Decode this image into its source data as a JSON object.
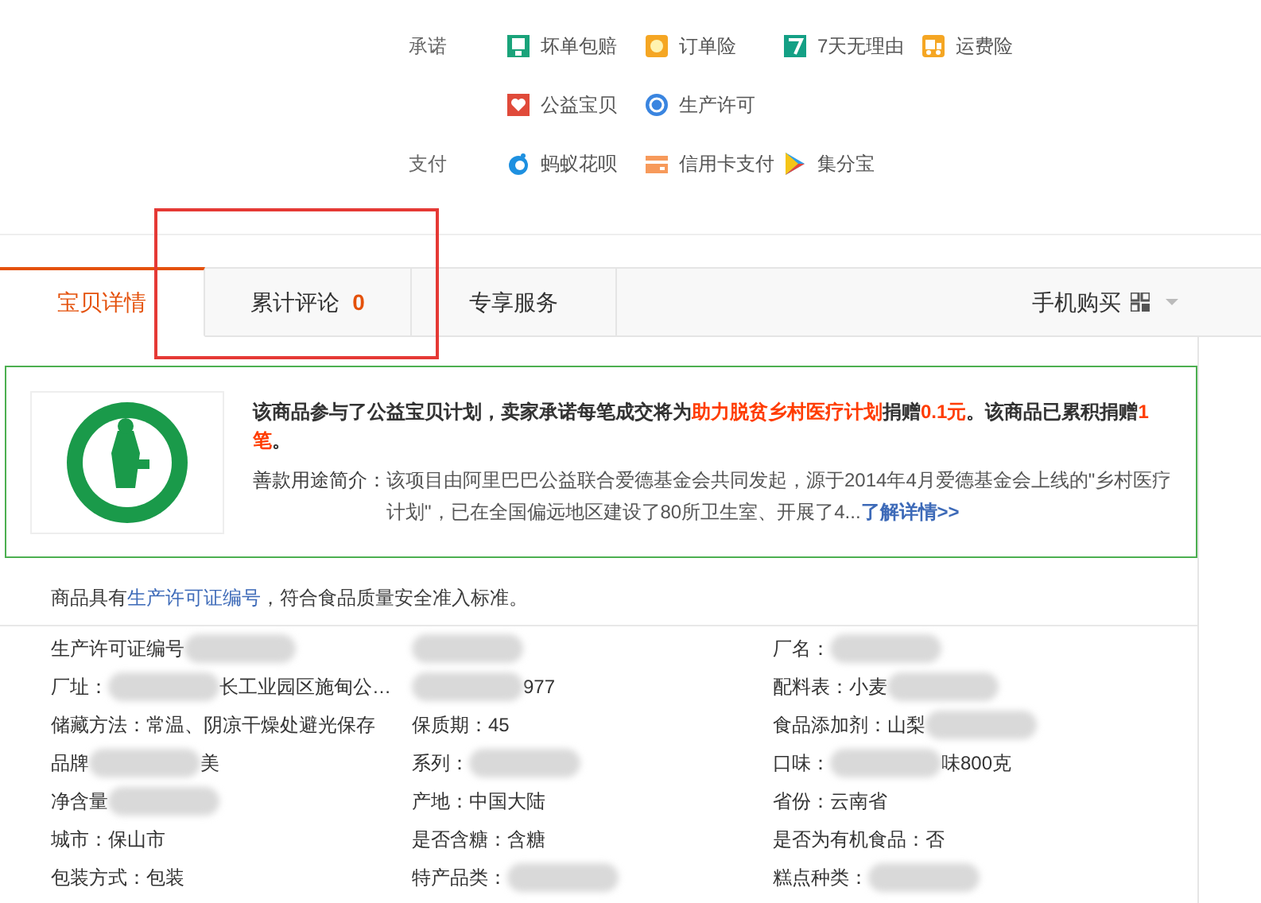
{
  "services": [
    {
      "label": "承诺",
      "items": [
        {
          "text": "坏单包赔",
          "kind": "refund"
        },
        {
          "text": "订单险",
          "kind": "sun"
        },
        {
          "text": "7天无理由",
          "kind": "seven"
        },
        {
          "text": "运费险",
          "kind": "truck"
        },
        {
          "text": "公益宝贝",
          "kind": "heart"
        },
        {
          "text": "生产许可",
          "kind": "license"
        }
      ]
    },
    {
      "label": "支付",
      "items": [
        {
          "text": "蚂蚁花呗",
          "kind": "drop"
        },
        {
          "text": "信用卡支付",
          "kind": "card"
        },
        {
          "text": "集分宝",
          "kind": "play"
        }
      ]
    }
  ],
  "tabs": [
    {
      "label": "宝贝详情",
      "selected": true
    },
    {
      "label": "累计评论",
      "count": "0",
      "selected": false
    },
    {
      "label": "专享服务",
      "selected": false
    }
  ],
  "mobile_buy": {
    "label": "手机购买"
  },
  "charity": {
    "lead": "该商品参与了公益宝贝计划，卖家承诺每笔成交将为**助力脱贫乡村医疗计划**捐赠**0.1元**。该商品已累积捐赠**1笔**。",
    "label": "善款用途简介：",
    "body": "该项目由阿里巴巴公益联合爱德基金会共同发起，源于2014年4月爱德基金会上线的\"乡村医疗计划\"，已在全国偏远地区建设了80所卫生室、开展了4...",
    "link": "了解详情>>"
  },
  "license_note": {
    "before": "商品具有",
    "link": "生产许可证编号",
    "after": "，符合食品质量安全准入标准。"
  },
  "attributes": [
    {
      "text": "生产许可证编号",
      "blurred": true
    },
    {
      "blurred": true
    },
    {
      "text": "厂名：",
      "blurred": true
    },
    {
      "text": "厂址：",
      "blurred": true,
      "tail": "长工业园区施甸公…"
    },
    {
      "blurred": true,
      "tail": "977"
    },
    {
      "text": "配料表：小麦",
      "blurred": true
    },
    {
      "text": "储藏方法：常温、阴凉干燥处避光保存",
      "blurred": false
    },
    {
      "text": "保质期：45",
      "blurred": false
    },
    {
      "text": "食品添加剂：山梨",
      "blurred": true
    },
    {
      "text": "品牌",
      "blurred": true,
      "tail": "美"
    },
    {
      "text": "系列：",
      "blurred": true
    },
    {
      "text": "口味：",
      "blurred": true,
      "tail": "味800克"
    },
    {
      "text": "净含量",
      "blurred": true
    },
    {
      "text": "产地：中国大陆",
      "blurred": false
    },
    {
      "text": "省份：云南省",
      "blurred": false
    },
    {
      "text": "城市：保山市",
      "blurred": false
    },
    {
      "text": "是否含糖：含糖",
      "blurred": false
    },
    {
      "text": "是否为有机食品：否",
      "blurred": false
    },
    {
      "text": "包装方式：包装",
      "blurred": false
    },
    {
      "text": "特产品类：",
      "blurred": true
    },
    {
      "text": "糕点种类：",
      "blurred": true
    }
  ]
}
